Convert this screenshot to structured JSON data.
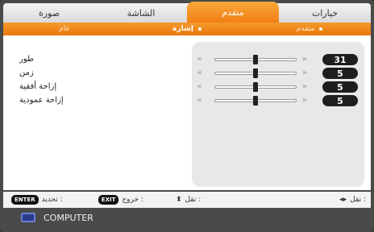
{
  "tabs": [
    {
      "label": "صورة",
      "active": false
    },
    {
      "label": "الشاشة",
      "active": false
    },
    {
      "label": "متقدم",
      "active": true
    },
    {
      "label": "خيارات",
      "active": false
    }
  ],
  "subtabs": [
    {
      "label": "عام",
      "active": false
    },
    {
      "label": "إشارة",
      "active": true
    },
    {
      "label": "متقدم",
      "active": false
    }
  ],
  "settings": [
    {
      "label": "طور",
      "value": "31",
      "level": 0.5
    },
    {
      "label": "زمن",
      "value": "5",
      "level": 0.5
    },
    {
      "label": "إزاحة أفقية",
      "value": "5",
      "level": 0.5
    },
    {
      "label": "إزاحة عمودية",
      "value": "5",
      "level": 0.5
    }
  ],
  "footer": {
    "enter_key": "ENTER",
    "enter_label": "تحديد :",
    "exit_key": "EXIT",
    "exit_label": "خروج :",
    "updown_label": "نقل :",
    "leftright_label": "نقل :"
  },
  "source": {
    "label": "COMPUTER"
  },
  "colors": {
    "accent": "#f07f14",
    "value_bg": "#1e1e1e"
  }
}
